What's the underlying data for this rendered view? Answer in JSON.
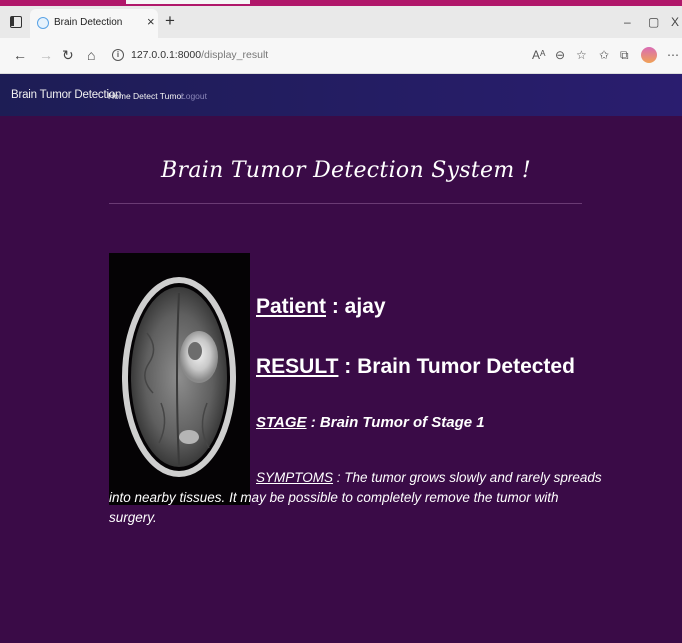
{
  "browser": {
    "tab_title": "Brain Detection",
    "tab_close": "×",
    "new_tab": "+",
    "window_controls": {
      "minimize": "–",
      "maximize": "▢",
      "close": "X"
    },
    "url_host": "127.0.0.1:8000",
    "url_path": "/display_result",
    "icons": [
      "back-arrow-icon",
      "forward-arrow-icon",
      "refresh-icon",
      "home-icon",
      "info-icon",
      "read-aloud-icon",
      "zoom-icon",
      "favorite-add-icon",
      "favorites-icon",
      "collections-icon",
      "profile-icon",
      "more-icon"
    ]
  },
  "navbar": {
    "brand": "Brain Tumor Detection",
    "links": [
      "Home",
      "Detect Tumor",
      "Logout"
    ],
    "background": "#1d1d55"
  },
  "page": {
    "heading": "Brain Tumor Detection System !",
    "background": "#3a0b47",
    "patient_label": "Patient",
    "patient_value": " : ajay",
    "result_label": "RESULT",
    "result_value": " : Brain Tumor Detected",
    "stage_label": "STAGE",
    "stage_value": " : Brain Tumor of Stage 1",
    "symptoms_label": "SYMPTOMS",
    "symptoms_value": " : The tumor grows slowly and rarely spreads into nearby tissues. It may be possible to completely remove the tumor with surgery."
  }
}
